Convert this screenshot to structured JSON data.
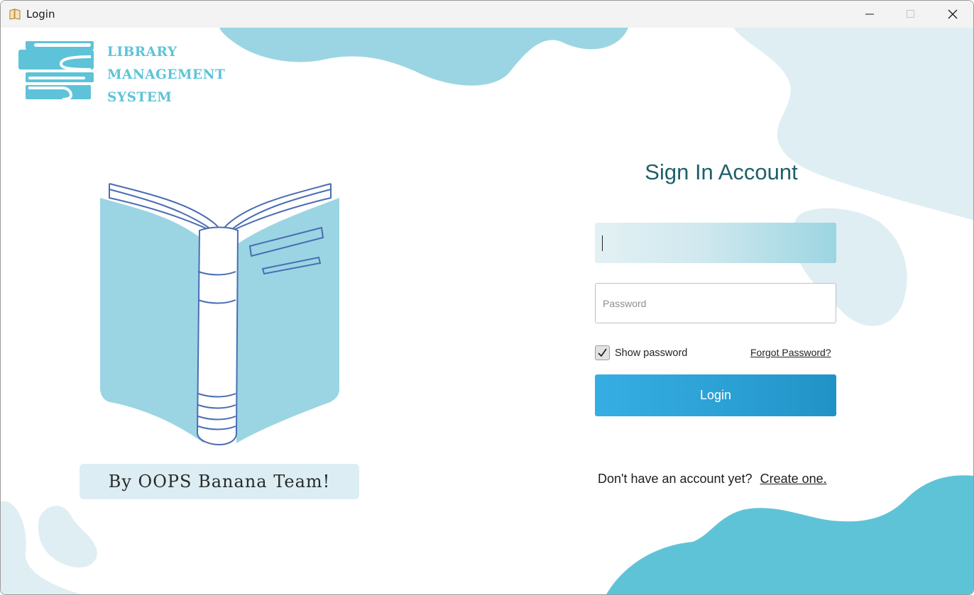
{
  "window": {
    "title": "Login",
    "app_icon": "book-icon",
    "controls": [
      "minimize-icon",
      "maximize-icon",
      "close-icon"
    ]
  },
  "branding": {
    "logo_line1": "LIBRARY",
    "logo_line2": "MANAGEMENT",
    "logo_line3": "SYSTEM",
    "team_tag": "By OOPS Banana Team!"
  },
  "form": {
    "title": "Sign In Account",
    "username_value": "",
    "password_placeholder": "Password",
    "show_password_label": "Show password",
    "show_password_checked": true,
    "forgot_password_label": "Forgot Password?",
    "login_label": "Login",
    "no_account_text": "Don't have an account yet?",
    "create_account_label": "Create one."
  },
  "colors": {
    "accent_blue": "#2ea6dc",
    "light_teal": "#9bd5e3",
    "pale_blue": "#dfeef3",
    "title_teal": "#1f5f6b",
    "logo_blue": "#5ec3d8"
  }
}
